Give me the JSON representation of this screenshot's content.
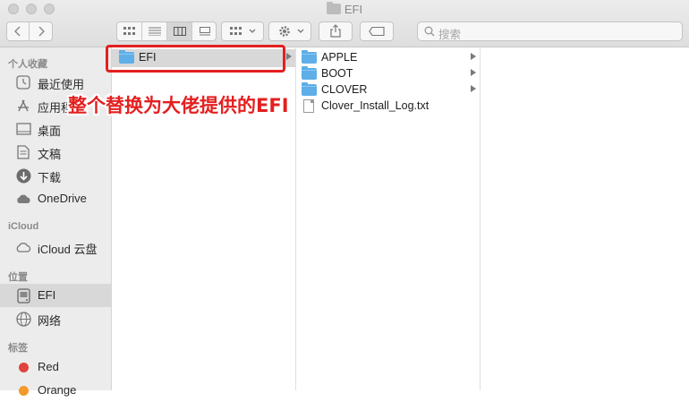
{
  "window": {
    "title": "EFI"
  },
  "toolbar": {
    "view_icons": [
      "grid-view-icon",
      "list-view-icon",
      "column-view-icon",
      "gallery-view-icon"
    ],
    "active_view": "column-view-icon"
  },
  "search": {
    "placeholder": "搜索"
  },
  "sidebar": {
    "favorites_header": "个人收藏",
    "favorites": [
      {
        "label": "最近使用",
        "icon": "clock-icon"
      },
      {
        "label": "应用程序",
        "icon": "applications-icon"
      },
      {
        "label": "桌面",
        "icon": "desktop-icon"
      },
      {
        "label": "文稿",
        "icon": "document-icon"
      },
      {
        "label": "下载",
        "icon": "download-icon"
      },
      {
        "label": "OneDrive",
        "icon": "cloud-icon"
      }
    ],
    "icloud_header": "iCloud",
    "icloud": [
      {
        "label": "iCloud 云盘",
        "icon": "icloud-icon"
      }
    ],
    "locations_header": "位置",
    "locations": [
      {
        "label": "EFI",
        "icon": "disk-icon",
        "selected": true
      },
      {
        "label": "网络",
        "icon": "network-icon"
      }
    ],
    "tags_header": "标签",
    "tags": [
      {
        "label": "Red",
        "color": "#e0443e"
      },
      {
        "label": "Orange",
        "color": "#f39a2b"
      }
    ]
  },
  "columns": {
    "col1": [
      {
        "name": "EFI",
        "type": "folder",
        "selected": true,
        "has_children": true
      }
    ],
    "col2": [
      {
        "name": "APPLE",
        "type": "folder",
        "has_children": true
      },
      {
        "name": "BOOT",
        "type": "folder",
        "has_children": true
      },
      {
        "name": "CLOVER",
        "type": "folder",
        "has_children": true
      },
      {
        "name": "Clover_Install_Log.txt",
        "type": "file",
        "has_children": false
      }
    ]
  },
  "annotation": {
    "text": "整个替换为大佬提供的EFI",
    "color": "#e41f1f"
  }
}
